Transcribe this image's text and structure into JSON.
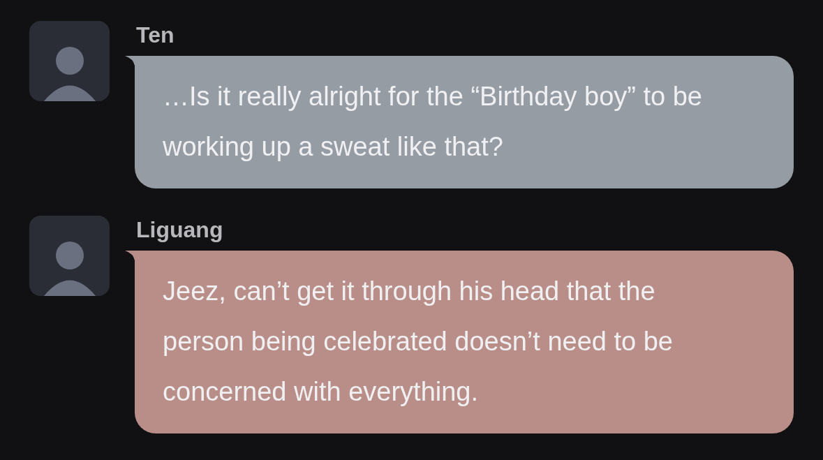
{
  "messages": [
    {
      "sender": "Ten",
      "text": "…Is it really alright for the “Birthday boy” to be working up a sweat like that?",
      "color": "#959ca4"
    },
    {
      "sender": "Liguang",
      "text": "Jeez, can’t get it through his head that the person being celebrated doesn’t need to be concerned with everything.",
      "color": "#b98e88"
    }
  ]
}
